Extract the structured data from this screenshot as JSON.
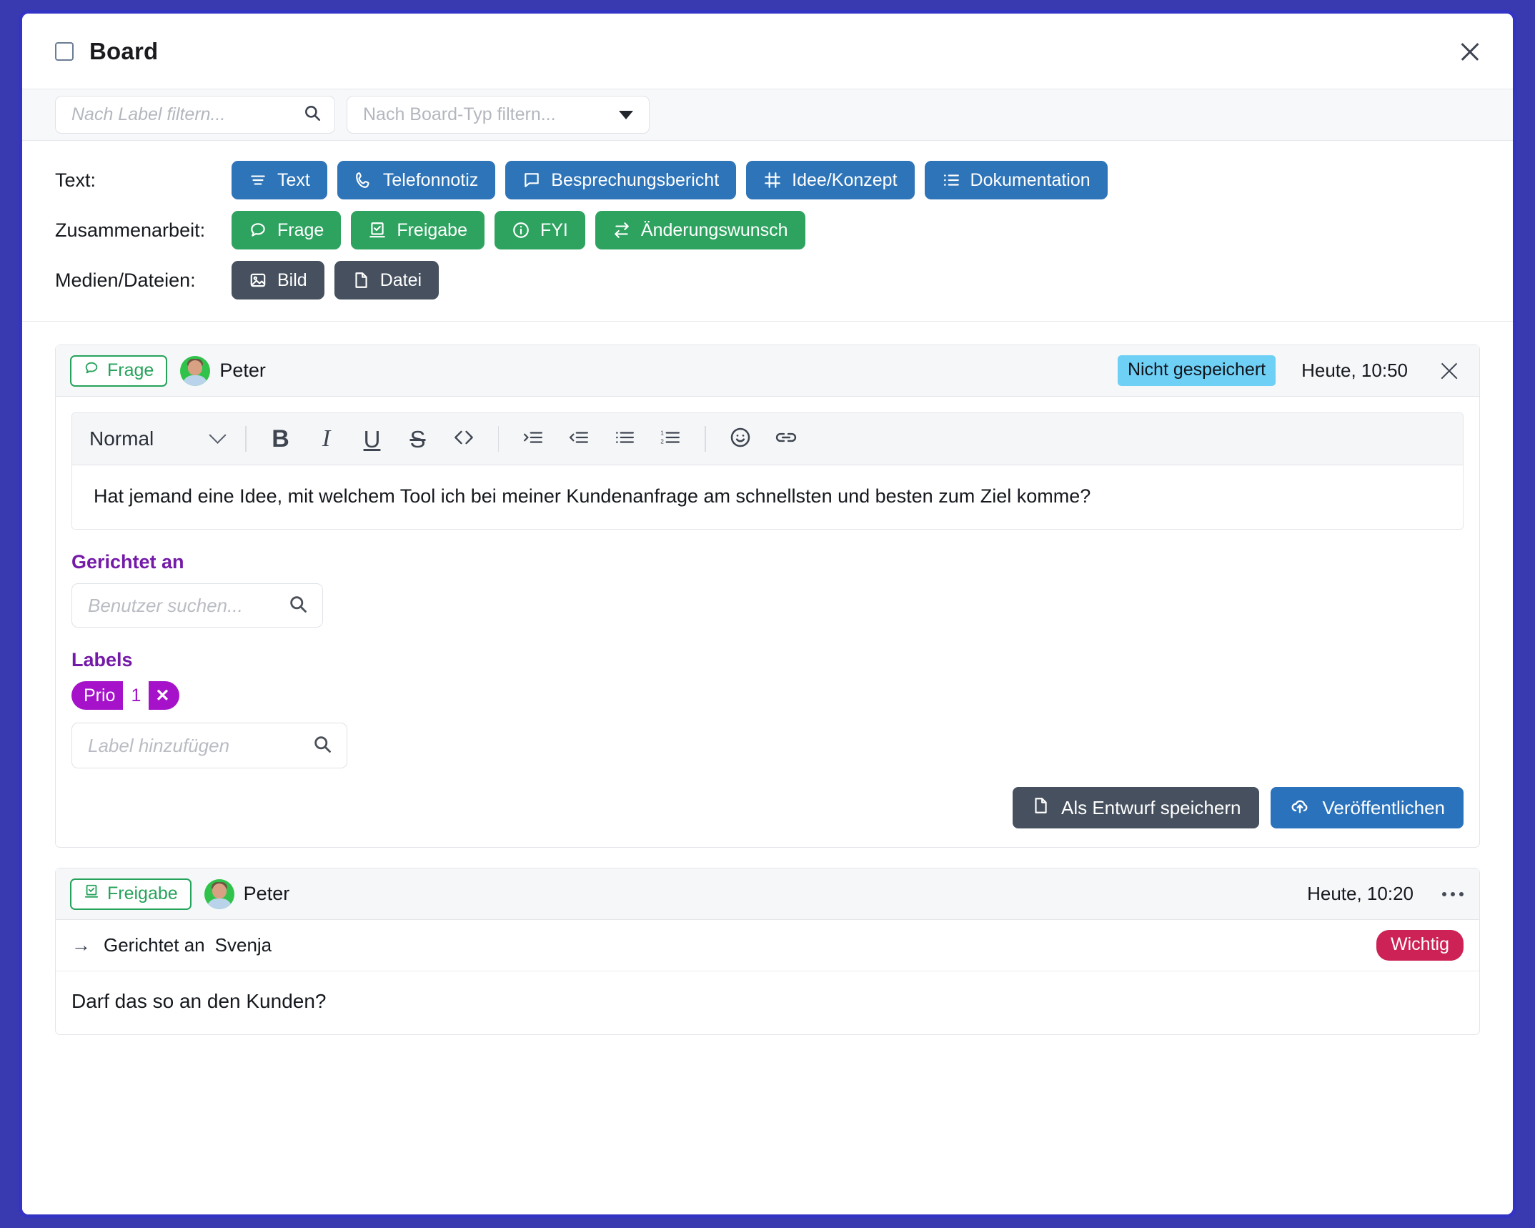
{
  "window": {
    "title": "Board",
    "close_label": "×",
    "checkbox_icon": "checkbox-icon"
  },
  "filters": {
    "label_filter_placeholder": "Nach Label filtern...",
    "type_filter_placeholder": "Nach Board-Typ filtern...",
    "search_icon": "search-icon",
    "caret_icon": "chevron-down-icon"
  },
  "type_groups": [
    {
      "label": "Text:",
      "color": "#2e74b8",
      "style": "blue",
      "buttons": [
        {
          "label": "Text",
          "icon": "text-lines-icon"
        },
        {
          "label": "Telefonnotiz",
          "icon": "phone-icon"
        },
        {
          "label": "Besprechungsbericht",
          "icon": "speech-bubble-icon"
        },
        {
          "label": "Idee/Konzept",
          "icon": "frame-icon"
        },
        {
          "label": "Dokumentation",
          "icon": "list-detail-icon"
        }
      ]
    },
    {
      "label": "Zusammenarbeit:",
      "color": "#2ea35f",
      "style": "green",
      "buttons": [
        {
          "label": "Frage",
          "icon": "question-bubble-icon"
        },
        {
          "label": "Freigabe",
          "icon": "ballot-check-icon"
        },
        {
          "label": "FYI",
          "icon": "info-circle-icon"
        },
        {
          "label": "Änderungswunsch",
          "icon": "exchange-arrows-icon"
        }
      ]
    },
    {
      "label": "Medien/Dateien:",
      "color": "#46505e",
      "style": "slate",
      "buttons": [
        {
          "label": "Bild",
          "icon": "image-icon"
        },
        {
          "label": "Datei",
          "icon": "file-icon"
        }
      ]
    }
  ],
  "draft_card": {
    "kind": "Frage",
    "kind_icon": "question-bubble-icon",
    "author": "Peter",
    "status": "Nicht gespeichert",
    "status_color": "#6fd0f5",
    "time": "Heute, 10:50",
    "close_icon": "close-icon",
    "editor": {
      "block_style": "Normal",
      "toolbar": [
        {
          "name": "bold-button",
          "glyph": "B"
        },
        {
          "name": "italic-button",
          "glyph": "I"
        },
        {
          "name": "underline-button",
          "glyph": "U"
        },
        {
          "name": "strikethrough-button",
          "glyph": "S"
        },
        {
          "name": "code-button",
          "glyph": "<>"
        },
        {
          "name": "indent-button",
          "glyph": "indent-icon"
        },
        {
          "name": "outdent-button",
          "glyph": "outdent-icon"
        },
        {
          "name": "bullet-list-button",
          "glyph": "bullet-list-icon"
        },
        {
          "name": "numbered-list-button",
          "glyph": "numbered-list-icon"
        },
        {
          "name": "emoji-button",
          "glyph": "smiley-icon"
        },
        {
          "name": "link-button",
          "glyph": "link-icon"
        }
      ],
      "body": "Hat jemand eine Idee, mit welchem Tool ich bei meiner Kundenanfrage am schnellsten und besten zum Ziel komme?"
    },
    "recipients": {
      "section_label": "Gerichtet an",
      "placeholder": "Benutzer suchen..."
    },
    "labels": {
      "section_label": "Labels",
      "chips": [
        {
          "name": "Prio",
          "count": "1",
          "remove": "✕",
          "color": "#a512c9"
        }
      ],
      "add_placeholder": "Label hinzufügen"
    },
    "buttons": {
      "draft": "Als Entwurf speichern",
      "draft_icon": "file-icon",
      "publish": "Veröffentlichen",
      "publish_icon": "cloud-upload-icon"
    }
  },
  "posted_card": {
    "kind": "Freigabe",
    "kind_icon": "ballot-check-icon",
    "author": "Peter",
    "time": "Heute, 10:20",
    "menu_icon": "more-horizontal-icon",
    "directed_label": "Gerichtet an",
    "directed_to": "Svenja",
    "arrow_icon": "arrow-right-icon",
    "priority_badge": "Wichtig",
    "priority_color": "#cc2255",
    "body": "Darf das so an den Kunden?"
  }
}
